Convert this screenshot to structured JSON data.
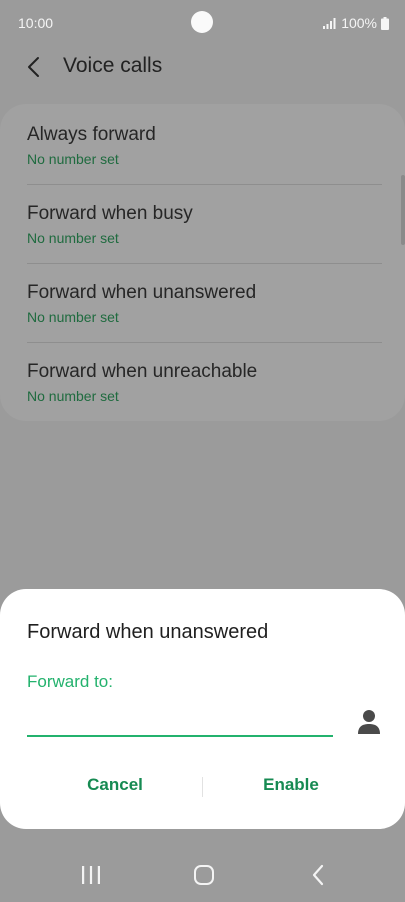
{
  "status_bar": {
    "time": "10:00",
    "battery": "100%",
    "icons": [
      "camera-cutout",
      "signal-icon",
      "battery-icon"
    ]
  },
  "app_bar": {
    "back_icon": "back-chevron-icon",
    "title": "Voice calls"
  },
  "forward_options": [
    {
      "title": "Always forward",
      "subtitle": "No number set"
    },
    {
      "title": "Forward when busy",
      "subtitle": "No number set"
    },
    {
      "title": "Forward when unanswered",
      "subtitle": "No number set"
    },
    {
      "title": "Forward when unreachable",
      "subtitle": "No number set"
    }
  ],
  "dialog": {
    "title": "Forward when unanswered",
    "label": "Forward to:",
    "input_value": "",
    "contact_icon": "contact-person-icon",
    "cancel_label": "Cancel",
    "enable_label": "Enable"
  },
  "nav_bar": {
    "icons": [
      "recent-apps-icon",
      "home-icon",
      "back-icon"
    ]
  },
  "colors": {
    "accent": "#23b26d",
    "button_text": "#168a52",
    "subtitle": "#1f6b3f",
    "scrim": "#9b9b9b",
    "dialog_bg": "#ffffff"
  }
}
